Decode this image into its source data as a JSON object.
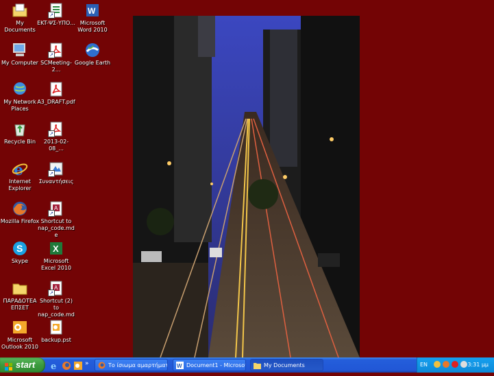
{
  "desktop": {
    "background_color": "#730405",
    "icons": [
      {
        "label": "My Documents",
        "icon": "folder-documents-icon"
      },
      {
        "label": "EKT-ΨΣ-ΥΠΟ...",
        "icon": "document-icon"
      },
      {
        "label": "Microsoft Word 2010",
        "icon": "word-icon"
      },
      {
        "label": "My Computer",
        "icon": "computer-icon"
      },
      {
        "label": "SCMeeting-2...",
        "icon": "pdf-icon"
      },
      {
        "label": "Google Earth",
        "icon": "google-earth-icon"
      },
      {
        "label": "My Network Places",
        "icon": "network-icon"
      },
      {
        "label": "A3_DRAFT.pdf",
        "icon": "pdf-icon"
      },
      {
        "label": "Recycle Bin",
        "icon": "recycle-bin-icon"
      },
      {
        "label": "2013-02-08_...",
        "icon": "pdf-icon"
      },
      {
        "label": "Internet Explorer",
        "icon": "internet-explorer-icon"
      },
      {
        "label": "Συναντήσεις",
        "icon": "shortcut-icon"
      },
      {
        "label": "Mozilla Firefox",
        "icon": "firefox-icon"
      },
      {
        "label": "Shortcut to nap_code.mde",
        "icon": "access-icon"
      },
      {
        "label": "Skype",
        "icon": "skype-icon"
      },
      {
        "label": "Microsoft Excel 2010",
        "icon": "excel-icon"
      },
      {
        "label": "ΠΑΡΑΔΟΤΕΑ ΕΠΣΕΤ",
        "icon": "folder-icon"
      },
      {
        "label": "Shortcut (2) to nap_code.mde",
        "icon": "access-icon"
      },
      {
        "label": "Microsoft Outlook 2010",
        "icon": "outlook-icon"
      },
      {
        "label": "backup.pst",
        "icon": "pst-file-icon"
      }
    ]
  },
  "taskbar": {
    "start_label": "start",
    "tasks": [
      {
        "label": "Το ίσιωμα αμαρτήματα...",
        "icon": "firefox-icon"
      },
      {
        "label": "Document1 - Microsof...",
        "icon": "word-icon"
      },
      {
        "label": "My Documents",
        "icon": "folder-icon"
      }
    ],
    "tray": {
      "language": "EN",
      "clock": "3:31 μμ"
    }
  }
}
